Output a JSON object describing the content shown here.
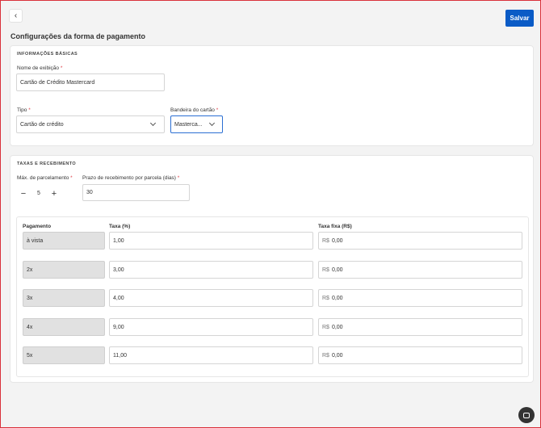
{
  "header": {
    "back_icon": "chevron-left-icon",
    "save_label": "Salvar",
    "page_title": "Configurações da forma de pagamento"
  },
  "basic_info": {
    "section_title": "INFORMAÇÕES BÁSICAS",
    "display_name_label": "Nome de exibição",
    "display_name_value": "Cartão de Crédito Mastercard",
    "type_label": "Tipo",
    "type_value": "Cartão de crédito",
    "brand_label": "Bandeira do cartão",
    "brand_value": "Masterca...",
    "required_mark": "*"
  },
  "fees": {
    "section_title": "TAXAS E RECEBIMENTO",
    "max_installments_label": "Máx. de parcelamento",
    "max_installments_value": "5",
    "minus_symbol": "−",
    "plus_symbol": "+",
    "receive_term_label": "Prazo de recebimento por parcela (dias)",
    "receive_term_value": "30",
    "col_payment": "Pagamento",
    "col_rate": "Taxa (%)",
    "col_fixed": "Taxa fixa (R$)",
    "currency_prefix": "R$",
    "rows": [
      {
        "payment": "à vista",
        "rate": "1,00",
        "fixed": "0,00"
      },
      {
        "payment": "2x",
        "rate": "3,00",
        "fixed": "0,00"
      },
      {
        "payment": "3x",
        "rate": "4,00",
        "fixed": "0,00"
      },
      {
        "payment": "4x",
        "rate": "9,00",
        "fixed": "0,00"
      },
      {
        "payment": "5x",
        "rate": "11,00",
        "fixed": "0,00"
      }
    ]
  },
  "chat_icon": "chat-icon",
  "colors": {
    "primary": "#0a5bc6",
    "frame": "#d9313b",
    "required": "#e0434b"
  }
}
